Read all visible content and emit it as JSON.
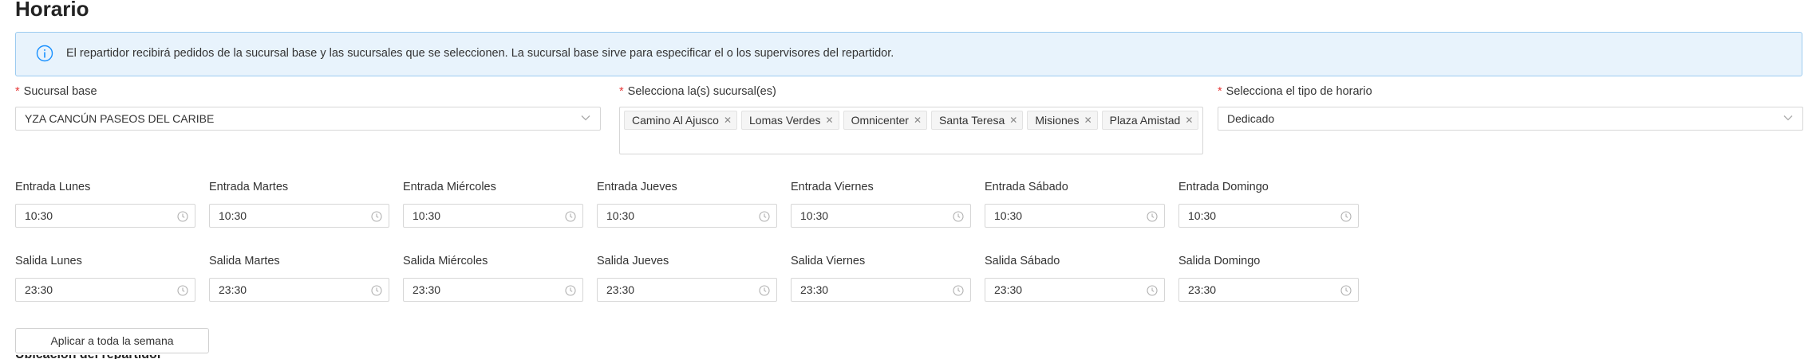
{
  "page_title": "Horario",
  "alert": {
    "icon": "info-icon",
    "message": "El repartidor recibirá pedidos de la sucursal base y las sucursales que se seleccionen. La sucursal base sirve para especificar el o los supervisores del repartidor."
  },
  "form": {
    "required_mark": "*",
    "base_branch": {
      "label": "Sucursal base",
      "value": "YZA CANCÚN PASEOS DEL CARIBE"
    },
    "branches": {
      "label": "Selecciona la(s) sucursal(es)",
      "selected": [
        "Camino Al Ajusco",
        "Lomas Verdes",
        "Omnicenter",
        "Santa Teresa",
        "Misiones",
        "Plaza Amistad"
      ]
    },
    "schedule_type": {
      "label": "Selecciona el tipo de horario",
      "value": "Dedicado"
    }
  },
  "entry": [
    {
      "label": "Entrada Lunes",
      "value": "10:30"
    },
    {
      "label": "Entrada Martes",
      "value": "10:30"
    },
    {
      "label": "Entrada Miércoles",
      "value": "10:30"
    },
    {
      "label": "Entrada Jueves",
      "value": "10:30"
    },
    {
      "label": "Entrada Viernes",
      "value": "10:30"
    },
    {
      "label": "Entrada Sábado",
      "value": "10:30"
    },
    {
      "label": "Entrada Domingo",
      "value": "10:30"
    }
  ],
  "exit": [
    {
      "label": "Salida Lunes",
      "value": "23:30"
    },
    {
      "label": "Salida Martes",
      "value": "23:30"
    },
    {
      "label": "Salida Miércoles",
      "value": "23:30"
    },
    {
      "label": "Salida Jueves",
      "value": "23:30"
    },
    {
      "label": "Salida Viernes",
      "value": "23:30"
    },
    {
      "label": "Salida Sábado",
      "value": "23:30"
    },
    {
      "label": "Salida Domingo",
      "value": "23:30"
    }
  ],
  "apply_button": "Aplicar a toda la semana",
  "next_section_title": "Ubicación del repartidor",
  "colors": {
    "alert_bg": "#e8f3fc",
    "alert_border": "#9ccbf0",
    "info_icon": "#1890ff",
    "required": "#e63a3a"
  }
}
